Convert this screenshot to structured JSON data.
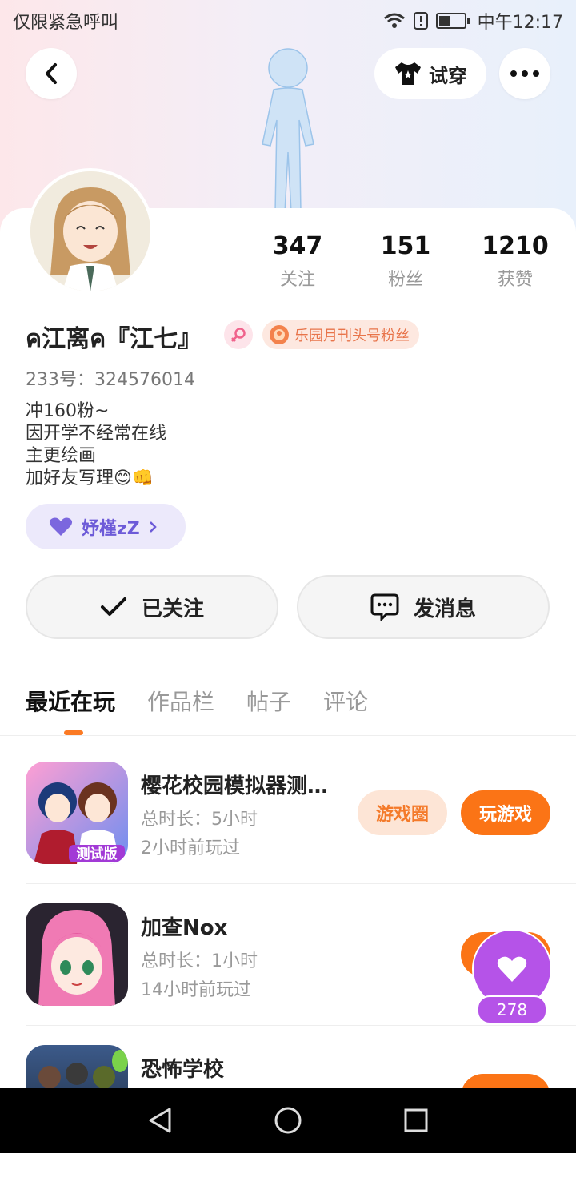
{
  "status_bar": {
    "carrier_text": "仅限紧急呼叫",
    "time": "中午12:17"
  },
  "header": {
    "try_on_label": "试穿"
  },
  "profile": {
    "stats": [
      {
        "value": "347",
        "label": "关注"
      },
      {
        "value": "151",
        "label": "粉丝"
      },
      {
        "value": "1210",
        "label": "获赞"
      }
    ],
    "name": "ค江离ค『江七』",
    "fan_badge": "乐园月刊头号粉丝",
    "uid": "233号：324576014",
    "bio": [
      "冲160粉~",
      "因开学不经常在线",
      "主更绘画",
      "加好友写理😊👊"
    ],
    "friend_tag": "妤槿zZ",
    "following_label": "已关注",
    "message_label": "发消息"
  },
  "tabs": [
    "最近在玩",
    "作品栏",
    "帖子",
    "评论"
  ],
  "games": [
    {
      "title": "樱花校园模拟器测试版",
      "duration": "总时长：5小时",
      "last_played": "2小时前玩过",
      "circle_label": "游戏圈",
      "play_label": "玩游戏",
      "icon_label": "测试版"
    },
    {
      "title": "加查Nox",
      "duration": "总时长：1小时",
      "last_played": "14小时前玩过"
    },
    {
      "title": "恐怖学校"
    }
  ],
  "floating_like": {
    "count": "278"
  },
  "colors": {
    "accent": "#fb7416",
    "purple": "#b553e8"
  }
}
